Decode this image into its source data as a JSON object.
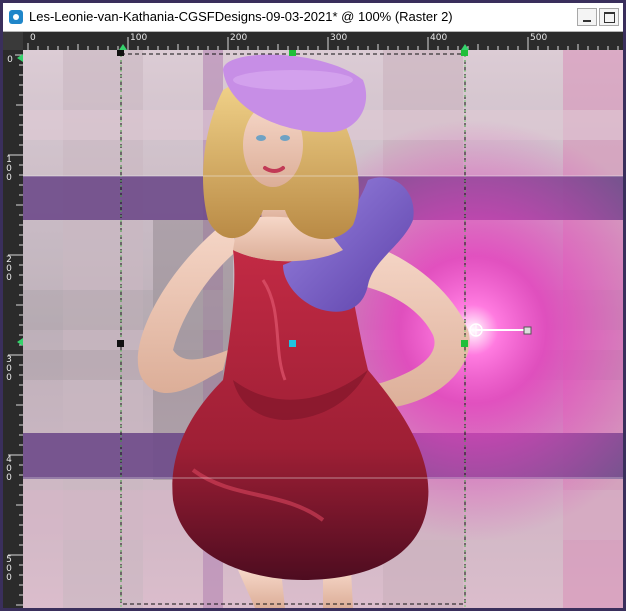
{
  "window": {
    "title": "Les-Leonie-van-Kathania-CGSFDesigns-09-03-2021* @ 100% (Raster 2)"
  },
  "ruler": {
    "top_labels": [
      "0",
      "100",
      "200",
      "300",
      "400",
      "500"
    ],
    "left_labels": [
      "0",
      "100",
      "200",
      "300",
      "400",
      "500"
    ]
  },
  "icons": {
    "app": "psp-app-icon",
    "minimize": "minimize-icon",
    "maximize": "maximize-icon",
    "transform_center": "crosshair-icon"
  },
  "colors": {
    "purple_band": "#6e4a8a",
    "pink_glow": "#e63fbf",
    "dress": "#9e1f35",
    "beret": "#c78ee6"
  }
}
